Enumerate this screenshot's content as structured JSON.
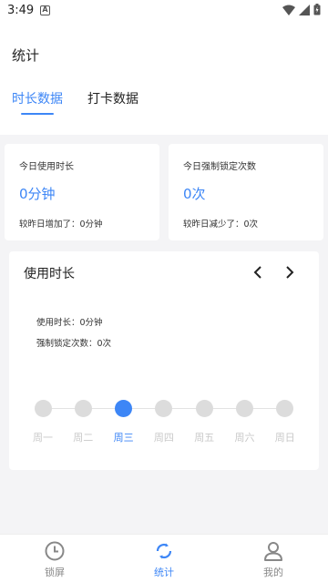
{
  "status_bar": {
    "time": "3:49",
    "notification_icon": "A"
  },
  "header": {
    "title": "统计"
  },
  "tabs": [
    {
      "label": "时长数据",
      "active": true
    },
    {
      "label": "打卡数据",
      "active": false
    }
  ],
  "today_card": {
    "label": "今日使用时长",
    "value": "0分钟",
    "compare": "较昨日增加了：0分钟"
  },
  "lock_card": {
    "label": "今日强制锁定次数",
    "value": "0次",
    "compare": "较昨日减少了：0次"
  },
  "usage_panel": {
    "title": "使用时长",
    "usage_line": "使用时长：0分钟",
    "lock_line": "强制锁定次数：0次",
    "days": [
      "周一",
      "周二",
      "周三",
      "周四",
      "周五",
      "周六",
      "周日"
    ],
    "selected_day_index": 2
  },
  "bottom_nav": [
    {
      "label": "锁屏",
      "icon": "clock-icon",
      "active": false
    },
    {
      "label": "统计",
      "icon": "refresh-circle-icon",
      "active": true
    },
    {
      "label": "我的",
      "icon": "user-icon",
      "active": false
    }
  ],
  "colors": {
    "accent": "#3d86f6",
    "inactive_dot": "#dcdcdc",
    "background": "#f4f4f6"
  }
}
